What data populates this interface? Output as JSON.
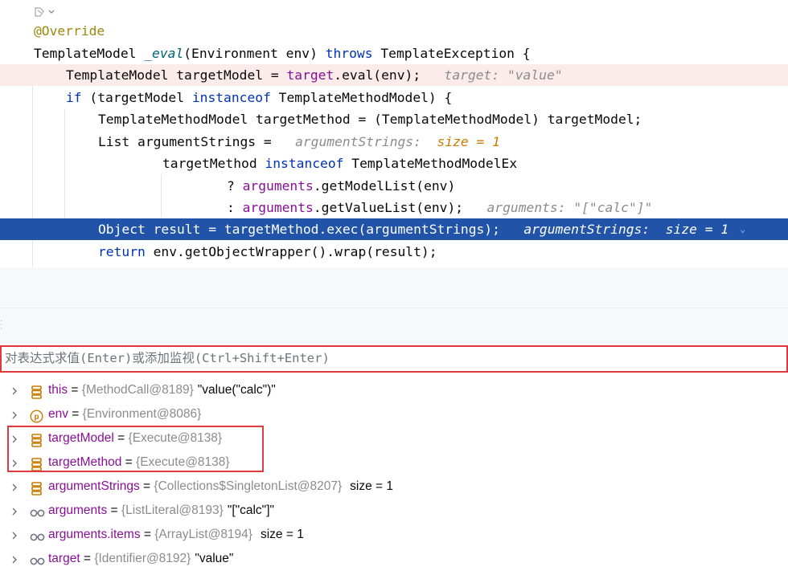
{
  "editor": {
    "lines": [
      {
        "tokens": [
          {
            "c": "ann",
            "t": "@Override"
          }
        ]
      },
      {
        "tokens": [
          {
            "c": "",
            "t": "TemplateModel "
          },
          {
            "c": "fn",
            "t": "_eval"
          },
          {
            "c": "",
            "t": "(Environment env) "
          },
          {
            "c": "kw",
            "t": "throws"
          },
          {
            "c": "",
            "t": " TemplateException {"
          }
        ]
      },
      {
        "tokens": [
          {
            "c": "",
            "t": "TemplateModel targetModel = "
          },
          {
            "c": "fld",
            "t": "target"
          },
          {
            "c": "",
            "t": ".eval(env);  "
          },
          {
            "c": "hint",
            "t": " target: \"value\""
          }
        ]
      },
      {
        "tokens": [
          {
            "c": "kw",
            "t": "if"
          },
          {
            "c": "",
            "t": " (targetModel "
          },
          {
            "c": "kw",
            "t": "instanceof"
          },
          {
            "c": "",
            "t": " TemplateMethodModel) {"
          }
        ]
      },
      {
        "tokens": [
          {
            "c": "",
            "t": "TemplateMethodModel targetMethod = (TemplateMethodModel) targetModel;"
          }
        ]
      },
      {
        "tokens": [
          {
            "c": "",
            "t": "List argumentStrings =  "
          },
          {
            "c": "hint",
            "t": " argumentStrings: "
          },
          {
            "c": "hint-o",
            "t": " size = 1"
          }
        ]
      },
      {
        "tokens": [
          {
            "c": "",
            "t": "targetMethod "
          },
          {
            "c": "kw",
            "t": "instanceof"
          },
          {
            "c": "",
            "t": " TemplateMethodModelEx"
          }
        ]
      },
      {
        "tokens": [
          {
            "c": "",
            "t": "? "
          },
          {
            "c": "fld",
            "t": "arguments"
          },
          {
            "c": "",
            "t": ".getModelList(env)"
          }
        ]
      },
      {
        "tokens": [
          {
            "c": "",
            "t": ": "
          },
          {
            "c": "fld",
            "t": "arguments"
          },
          {
            "c": "",
            "t": ".getValueList(env);  "
          },
          {
            "c": "hint",
            "t": " arguments: \"[\"calc\"]\""
          }
        ]
      },
      {
        "tokens": [
          {
            "c": "",
            "t": "Object result = targetMethod.exec(argumentStrings);  "
          },
          {
            "c": "hint",
            "t": " argumentStrings:  size = 1"
          }
        ]
      },
      {
        "tokens": [
          {
            "c": "kw",
            "t": "return"
          },
          {
            "c": "",
            "t": " env.getObjectWrapper().wrap(result);"
          }
        ]
      }
    ]
  },
  "evaluate": {
    "placeholder": "对表达式求值(Enter)或添加监视(Ctrl+Shift+Enter)"
  },
  "variables": [
    {
      "icon": "field-icon",
      "name": "this",
      "type": "{MethodCall@8189}",
      "value": "\"value(\"calc\")\""
    },
    {
      "icon": "parameter-icon",
      "name": "env",
      "type": "{Environment@8086}",
      "value": ""
    },
    {
      "icon": "field-icon",
      "name": "targetModel",
      "type": "{Execute@8138}",
      "value": ""
    },
    {
      "icon": "field-icon",
      "name": "targetMethod",
      "type": "{Execute@8138}",
      "value": ""
    },
    {
      "icon": "field-icon",
      "name": "argumentStrings",
      "type": "{Collections$SingletonList@8207}",
      "value": "size = 1"
    },
    {
      "icon": "watch-icon",
      "name": "arguments",
      "type": "{ListLiteral@8193}",
      "value": "\"[\"calc\"]\""
    },
    {
      "icon": "watch-icon",
      "name": "arguments.items",
      "type": "{ArrayList@8194}",
      "value": "size = 1"
    },
    {
      "icon": "watch-icon",
      "name": "target",
      "type": "{Identifier@8192}",
      "value": "\"value\""
    }
  ]
}
